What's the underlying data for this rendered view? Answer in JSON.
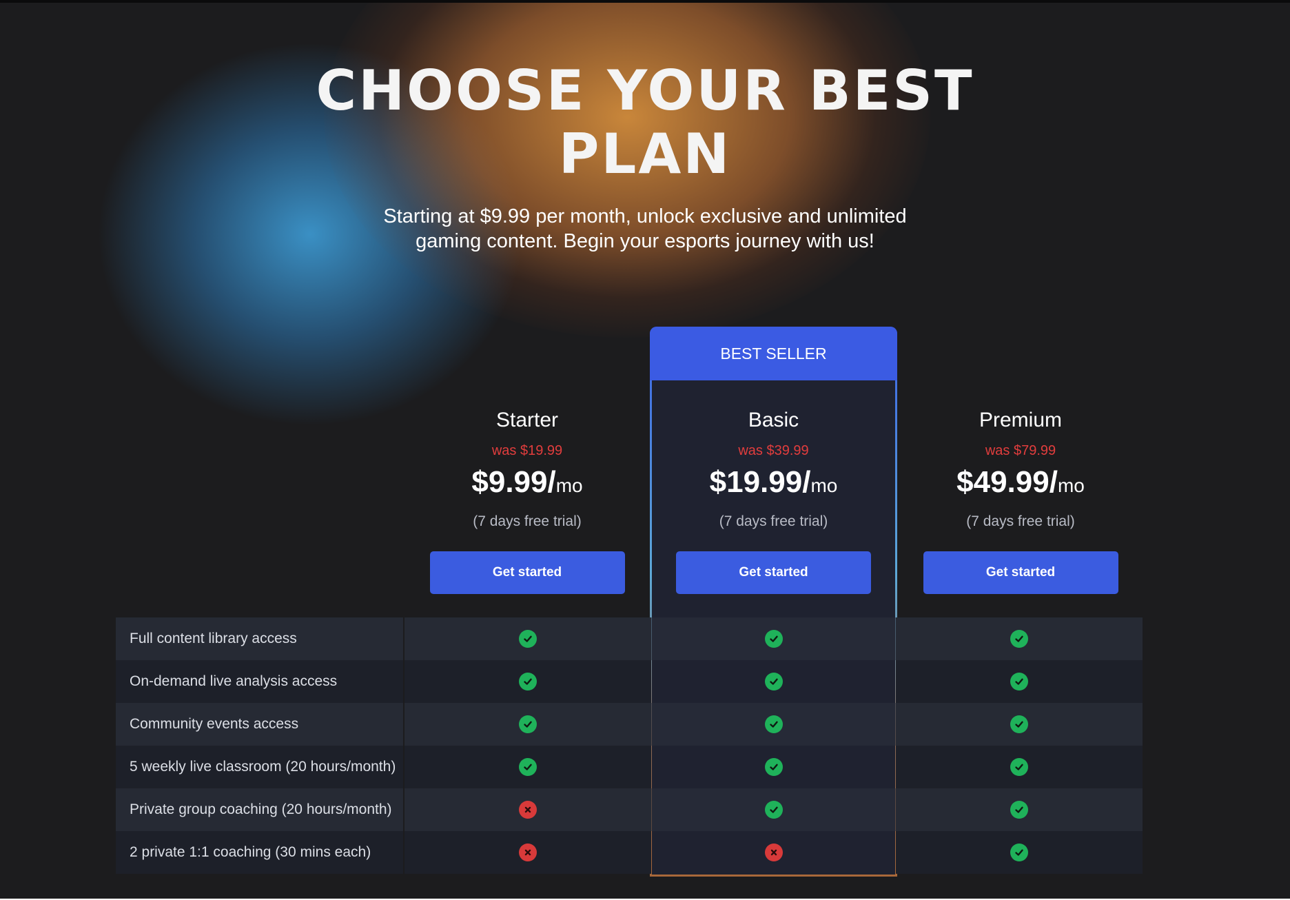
{
  "hero": {
    "title_line1": "CHOOSE YOUR BEST",
    "title_line2": "PLAN",
    "subtitle_line1": "Starting at $9.99 per month, unlock exclusive and unlimited",
    "subtitle_line2": "gaming content. Begin your esports journey with us!"
  },
  "badge": "BEST SELLER",
  "plans": [
    {
      "name": "Starter",
      "was": "was $19.99",
      "price": "$9.99/",
      "period": "mo",
      "trial": "(7 days free trial)",
      "cta": "Get started"
    },
    {
      "name": "Basic",
      "was": "was $39.99",
      "price": "$19.99/",
      "period": "mo",
      "trial": "(7 days free trial)",
      "cta": "Get started"
    },
    {
      "name": "Premium",
      "was": "was $79.99",
      "price": "$49.99/",
      "period": "mo",
      "trial": "(7 days free trial)",
      "cta": "Get started"
    }
  ],
  "features": [
    {
      "label": "Full content library access",
      "starter": true,
      "basic": true,
      "premium": true
    },
    {
      "label": "On-demand live analysis access",
      "starter": true,
      "basic": true,
      "premium": true
    },
    {
      "label": "Community events access",
      "starter": true,
      "basic": true,
      "premium": true
    },
    {
      "label": "5 weekly live classroom (20 hours/month)",
      "starter": true,
      "basic": true,
      "premium": true
    },
    {
      "label": "Private group coaching (20 hours/month)",
      "starter": false,
      "basic": true,
      "premium": true
    },
    {
      "label": "2 private 1:1 coaching (30 mins each)",
      "starter": false,
      "basic": false,
      "premium": true
    }
  ],
  "icons": {
    "included": "check-circle-icon",
    "excluded": "x-circle-icon"
  },
  "colors": {
    "background": "#1c1c1e",
    "accent": "#3b5ce0",
    "price_was": "#e23d3d",
    "included": "#1fb25a",
    "excluded": "#d83a3a"
  }
}
